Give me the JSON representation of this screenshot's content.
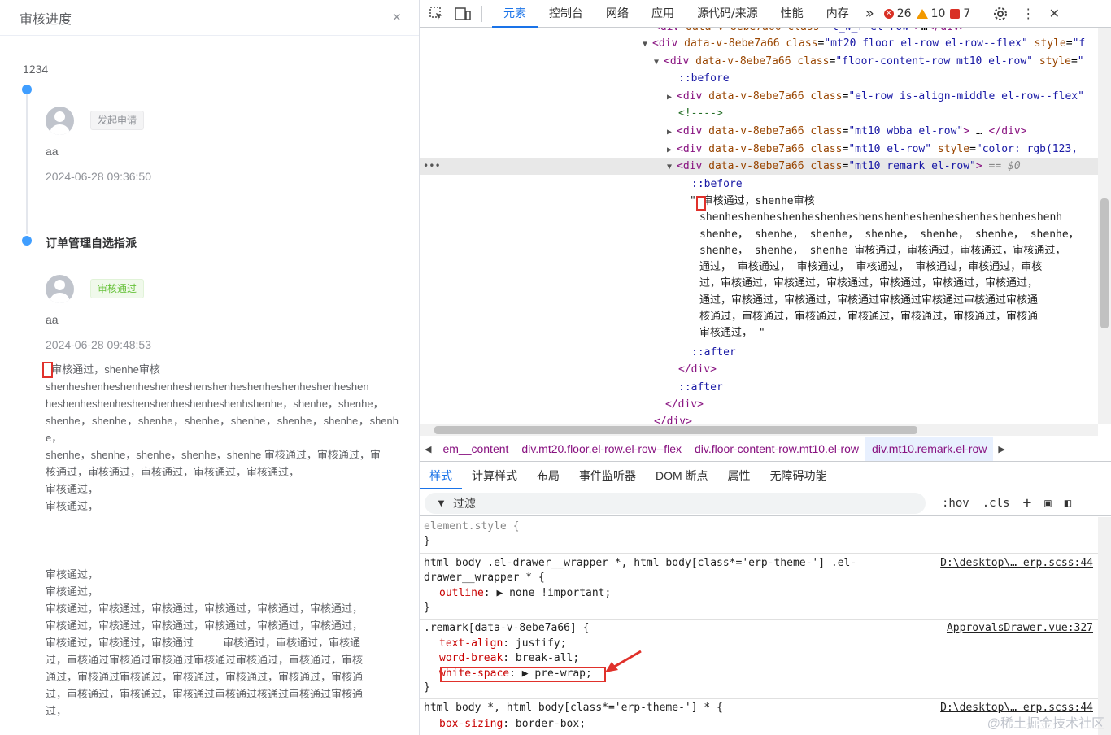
{
  "drawer": {
    "title": "审核进度",
    "close_icon": "×",
    "record_id": "1234",
    "node1": {
      "tag": "发起申请",
      "user": "aa",
      "time": "2024-06-28 09:36:50"
    },
    "node2": {
      "title": "订单管理自选指派",
      "tag": "审核通过",
      "user": "aa",
      "time": "2024-06-28 09:48:53",
      "remark": "  审核通过，shenhe审核\nshenheshenheshenheshenheshenshenheshenheshenheshenheshen\nheshenheshenheshenshenheshenheshenhshenhe，shenhe，shenhe，\nshenhe，shenhe，shenhe，shenhe，shenhe，shenhe，shenhe，shenhe，\nshenhe，shenhe，shenhe，shenhe，shenhe 审核通过，审核通过，审\n核通过，审核通过，审核通过，审核通过，审核通过，\n审核通过，\n审核通过，\n\n\n\n审核通过，\n审核通过，\n审核通过，审核通过，审核通过，审核通过，审核通过，审核通过，\n审核通过，审核通过，审核通过，审核通过，审核通过，审核通过，\n审核通过，审核通过，审核通过          审核通过，审核通过，审核通\n过，审核通过审核通过审核通过审核通过审核通过，审核通过，审核\n通过，审核通过审核通过，审核通过，审核通过，审核通过，审核通\n过，审核通过，审核通过，审核通过审核通过核通过审核通过审核通\n过，"
    }
  },
  "devtools": {
    "tabs": [
      "元素",
      "控制台",
      "网络",
      "应用",
      "源代码/来源",
      "性能",
      "内存"
    ],
    "more_tabs": "»",
    "errors": "26",
    "warnings": "10",
    "issues": "7",
    "dom_lines": [
      {
        "html": "<span class='tg'>&lt;div</span> <span class='an'>data-v-8ebe7a66</span> <span class='an'>class</span>=<span class='av'>\"l_w_r el-row\"</span><span class='tg'>&gt;</span>…<span class='tg'>&lt;/div&gt;</span>"
      },
      {
        "html": "<span class='tg'>&lt;div</span> <span class='an'>data-v-8ebe7a66</span> <span class='an'>class</span>=<span class='av'>\"mt20 floor el-row el-row--flex\"</span> <span class='an'>style</span>=<span class='av'>\"f</span>"
      },
      {
        "html": "<span class='tg'>&lt;div</span> <span class='an'>data-v-8ebe7a66</span> <span class='an'>class</span>=<span class='av'>\"floor-content-row mt10 el-row\"</span> <span class='an'>style</span>=<span class='av'>\"</span>"
      },
      {
        "html": "<span class='pe'>::before</span>"
      },
      {
        "html": "<span class='tg'>&lt;div</span> <span class='an'>data-v-8ebe7a66</span> <span class='an'>class</span>=<span class='av'>\"el-row is-align-middle el-row--flex\"</span>"
      },
      {
        "html": "<span class='cm'>&lt;!----&gt;</span>"
      },
      {
        "html": "<span class='tg'>&lt;div</span> <span class='an'>data-v-8ebe7a66</span> <span class='an'>class</span>=<span class='av'>\"mt10 wbba el-row\"</span><span class='tg'>&gt;</span> … <span class='tg'>&lt;/div&gt;</span>"
      },
      {
        "html": "<span class='tg'>&lt;div</span> <span class='an'>data-v-8ebe7a66</span> <span class='an'>class</span>=<span class='av'>\"mt10 el-row\"</span> <span class='an'>style</span>=<span class='av'>\"color: rgb(123, </span>"
      },
      {
        "html": "<span class='tg'>&lt;div</span> <span class='an'>data-v-8ebe7a66</span> <span class='an'>class</span>=<span class='av'>\"mt10 remark el-row\"</span><span class='tg'>&gt;</span> <span class='dim'>== $0</span>"
      },
      {
        "html": "<span class='pe'>::before</span>"
      },
      {
        "html": "<span class='pe'>::after</span>"
      },
      {
        "html": "<span class='tg'>&lt;/div&gt;</span>"
      },
      {
        "html": "<span class='pe'>::after</span>"
      },
      {
        "html": "<span class='tg'>&lt;/div&gt;</span>"
      },
      {
        "html": "<span class='tg'>&lt;/div&gt;</span>"
      }
    ],
    "dom_text": [
      "\"  审核通过，shenhe审核",
      "shenheshenheshenheshenheshenshenheshenheshenheshenheshenh",
      "shenhe， shenhe， shenhe， shenhe， shenhe， shenhe， shenhe，",
      "shenhe， shenhe， shenhe 审核通过，审核通过，审核通过，审核通过，",
      "通过，  审核通过，  审核通过，  审核通过，  审核通过，审核通过，审核",
      "过，审核通过，审核通过，审核通过，审核通过，审核通过，审核通过，",
      "通过，审核通过，审核通过，审核通过审核通过审核通过审核通过审核通",
      "核通过，审核通过，审核通过，审核通过，审核通过，审核通过，审核通",
      "审核通过， \""
    ],
    "more_dots": "•••",
    "crumbs": [
      "em__content",
      "div.mt20.floor.el-row.el-row--flex",
      "div.floor-content-row.mt10.el-row",
      "div.mt10.remark.el-row"
    ],
    "style_tabs": [
      "样式",
      "计算样式",
      "布局",
      "事件监听器",
      "DOM 断点",
      "属性",
      "无障碍功能"
    ],
    "filter_placeholder": "过滤",
    "filter_hov": ":hov",
    "filter_cls": ".cls",
    "rules": {
      "element_style": "element.style {",
      "close": "}",
      "r1_sel1": "html body .el-drawer__wrapper *, html body[class*='erp-theme-'] .el-",
      "r1_sel2": "drawer__wrapper * {",
      "r1_src": "D:\\desktop\\… erp.scss:44",
      "r1_prop": "outline",
      "r1_val": ": ▶ none !important;",
      "r2_sel": ".remark[data-v-8ebe7a66] {",
      "r2_src": "ApprovalsDrawer.vue:327",
      "r2_p1": "text-align",
      "r2_v1": ": justify;",
      "r2_p2": "word-break",
      "r2_v2": ": break-all;",
      "r2_p3": "white-space",
      "r2_v3": ": ▶ pre-wrap;",
      "r3_sel": "html body *, html body[class*='erp-theme-'] * {",
      "r3_src": "D:\\desktop\\… erp.scss:44",
      "r3_p1": "box-sizing",
      "r3_v1": ": border-box;"
    },
    "watermark": "@稀土掘金技术社区"
  },
  "colors": {
    "accent": "#409eff",
    "highlight_red": "#e0312b",
    "devtools_blue": "#1a73e8"
  }
}
